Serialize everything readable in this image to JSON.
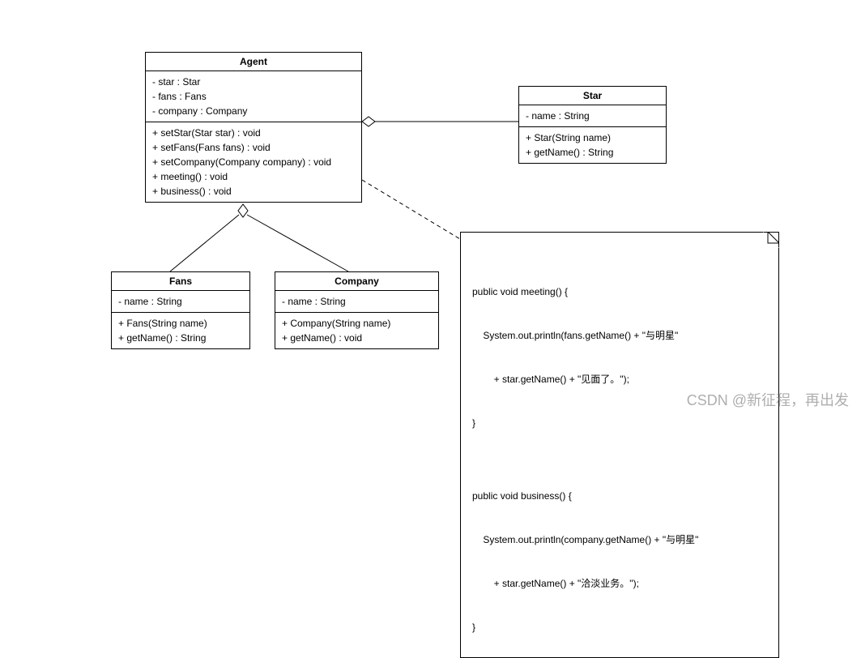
{
  "classes": {
    "agent": {
      "name": "Agent",
      "attrs": [
        "- star : Star",
        "- fans : Fans",
        "- company : Company"
      ],
      "ops": [
        "+ setStar(Star star) : void",
        "+ setFans(Fans fans) : void",
        "+ setCompany(Company company) : void",
        "+ meeting() : void",
        "+ business() : void"
      ]
    },
    "star": {
      "name": "Star",
      "attrs": [
        "- name : String"
      ],
      "ops": [
        "+ Star(String name)",
        "+ getName() : String"
      ]
    },
    "fans": {
      "name": "Fans",
      "attrs": [
        "- name : String"
      ],
      "ops": [
        "+ Fans(String name)",
        "+ getName() : String"
      ]
    },
    "company": {
      "name": "Company",
      "attrs": [
        "- name : String"
      ],
      "ops": [
        "+ Company(String name)",
        "+ getName() : void"
      ]
    }
  },
  "note": {
    "lines": [
      "public void meeting() {",
      "    System.out.println(fans.getName() + \"与明星\"",
      "        + star.getName() + \"见面了。\");",
      "}",
      "",
      "public void business() {",
      "    System.out.println(company.getName() + \"与明星\"",
      "        + star.getName() + \"洽淡业务。\");",
      "}"
    ]
  },
  "watermark": "CSDN @新征程，再出发"
}
